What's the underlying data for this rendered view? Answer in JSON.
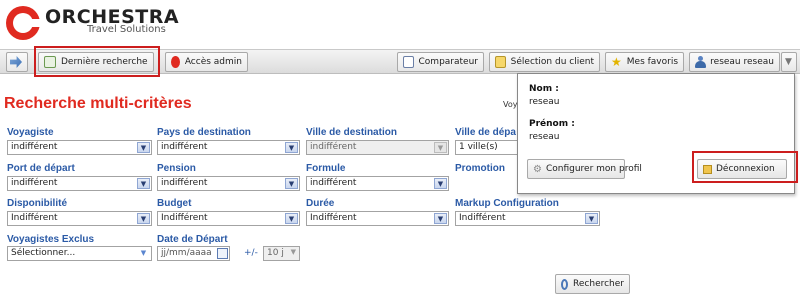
{
  "brand": {
    "name": "ORCHESTRA",
    "subtitle": "Travel Solutions",
    "color": "#e02a20"
  },
  "toolbar": {
    "home_icon": "arrow-icon",
    "derniere_recherche": "Dernière recherche",
    "acces_admin": "Accès admin",
    "comparateur": "Comparateur",
    "selection_client": "Sélection du client",
    "mes_favoris": "Mes favoris",
    "user": "reseau reseau"
  },
  "page": {
    "title": "Recherche multi-critères",
    "voy_truncated": "Voy"
  },
  "form": {
    "voyagiste": {
      "label": "Voyagiste",
      "value": "indifférent"
    },
    "pays_destination": {
      "label": "Pays de destination",
      "value": "indifférent"
    },
    "ville_destination": {
      "label": "Ville de destination",
      "value": "indifférent"
    },
    "ville_depart": {
      "label": "Ville de dépa",
      "value": "1 ville(s)"
    },
    "port_depart": {
      "label": "Port de départ",
      "value": "indifférent"
    },
    "pension": {
      "label": "Pension",
      "value": "indifférent"
    },
    "formule": {
      "label": "Formule",
      "value": "indifférent"
    },
    "promotion": {
      "label": "Promotion"
    },
    "disponibilite": {
      "label": "Disponibilité",
      "value": "Indifférent"
    },
    "budget": {
      "label": "Budget",
      "value": "Indifférent"
    },
    "duree": {
      "label": "Durée",
      "value": "Indifférent"
    },
    "markup": {
      "label": "Markup Configuration",
      "value": "Indifférent"
    },
    "voyagistes_exclus": {
      "label": "Voyagistes Exclus",
      "value": "Sélectionner..."
    },
    "date_depart": {
      "label": "Date de Départ",
      "placeholder": "jj/mm/aaaa",
      "tolerance_label": "+/-",
      "tolerance_value": "10 j"
    }
  },
  "popup": {
    "nom_label": "Nom :",
    "nom_value": "reseau",
    "prenom_label": "Prénom :",
    "prenom_value": "reseau",
    "configurer": "Configurer mon profil",
    "deconnexion": "Déconnexion"
  },
  "actions": {
    "rechercher": "Rechercher"
  },
  "colors": {
    "highlight": "#cc1e1e",
    "label_blue": "#2b5aa6",
    "title_red": "#e02a20"
  }
}
